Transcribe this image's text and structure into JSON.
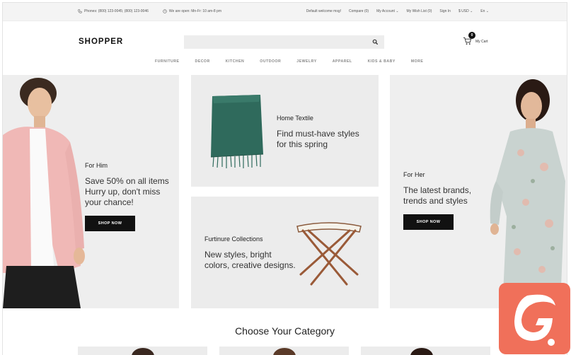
{
  "topbar": {
    "phones": "Phones: (800) 123-0045; (800) 123-0046",
    "hours": "We are open: Mn-Fr: 10 am-8 pm",
    "welcome": "Default welcome msg!",
    "compare": "Compare (0)",
    "account": "My Account",
    "wishlist": "My Wish List (0)",
    "signin": "Sign In",
    "currency": "$ USD",
    "language": "En"
  },
  "header": {
    "logo": "SHOPPER",
    "search_placeholder": "",
    "cart_count": "0",
    "cart_label": "My Cart"
  },
  "nav": [
    "FURNITURE",
    "DECOR",
    "KITCHEN",
    "OUTDOOR",
    "JEWELRY",
    "APPAREL",
    "KIDS & BABY",
    "MORE"
  ],
  "banners": {
    "him": {
      "subtitle": "For Him",
      "line1": "Save 50% on all items",
      "line2": "Hurry up, don't miss",
      "line3": "your chance!",
      "button": "SHOP NOW"
    },
    "textile": {
      "subtitle": "Home Textile",
      "line1": "Find must-have styles",
      "line2": "for this spring"
    },
    "furniture": {
      "subtitle": "Furtinure Collections",
      "line1": "New styles, bright",
      "line2": "colors, creative designs."
    },
    "her": {
      "subtitle": "For Her",
      "line1": "The latest brands,",
      "line2": "trends and styles",
      "button": "SHOP NOW"
    }
  },
  "category_title": "Choose Your Category",
  "colors": {
    "button": "#111111",
    "brand_badge": "#f0705a",
    "banner_bg": "#eeeeee"
  }
}
